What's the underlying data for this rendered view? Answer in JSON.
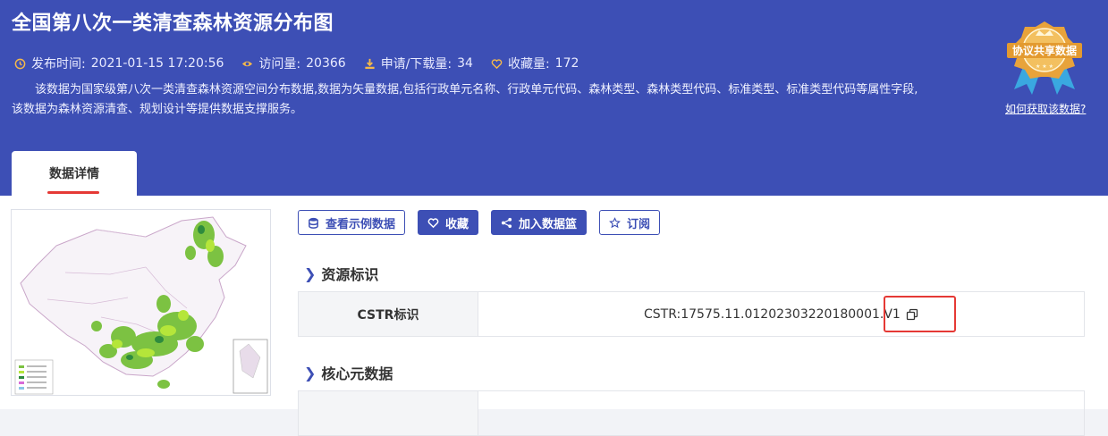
{
  "header": {
    "title": "全国第八次一类清查森林资源分布图",
    "meta": {
      "publish_label": "发布时间:",
      "publish_value": "2021-01-15 17:20:56",
      "views_label": "访问量:",
      "views_value": "20366",
      "downloads_label": "申请/下载量:",
      "downloads_value": "34",
      "favorites_label": "收藏量:",
      "favorites_value": "172"
    },
    "description": "该数据为国家级第八次一类清查森林资源空间分布数据,数据为矢量数据,包括行政单元名称、行政单元代码、森林类型、森林类型代码、标准类型、标准类型代码等属性字段,该数据为森林资源清查、规划设计等提供数据支撑服务。",
    "badge_text": "协议共享数据",
    "how_to_link": "如何获取该数据?"
  },
  "tab": {
    "label": "数据详情"
  },
  "actions": {
    "view_sample": "查看示例数据",
    "favorite": "收藏",
    "add_basket": "加入数据篮",
    "subscribe": "订阅"
  },
  "sections": {
    "resource_id": "资源标识",
    "core_meta": "核心元数据"
  },
  "cstr": {
    "label": "CSTR标识",
    "value": "CSTR:17575.11.01202303220180001.V1"
  },
  "colors": {
    "brand": "#3d4fb5",
    "highlight": "#e53935",
    "badge_gold": "#e8a33b",
    "ribbon": "#3aa8e0"
  }
}
